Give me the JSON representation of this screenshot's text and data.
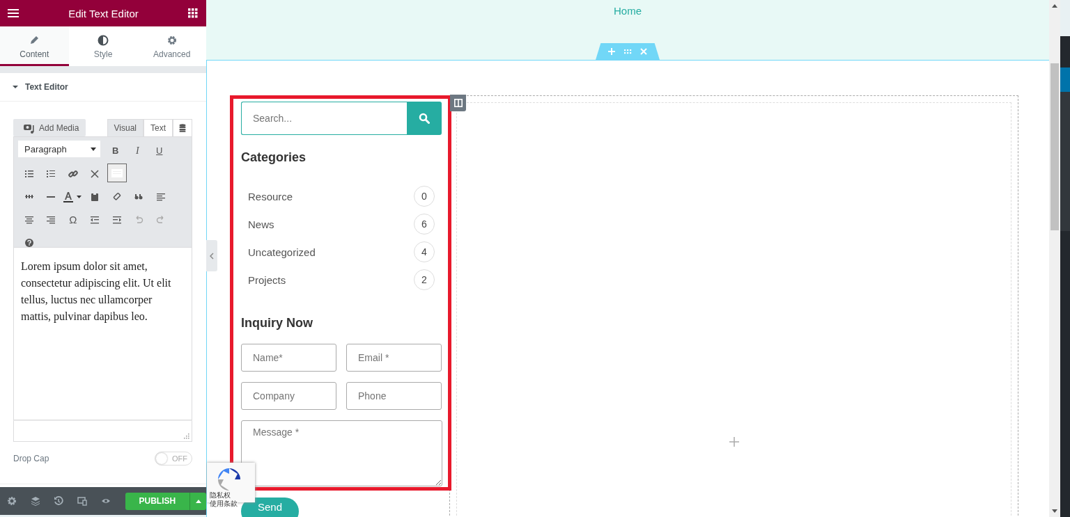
{
  "panel": {
    "title": "Edit Text Editor",
    "tabs": [
      {
        "label": "Content",
        "selected": true
      },
      {
        "label": "Style",
        "selected": false
      },
      {
        "label": "Advanced",
        "selected": false
      }
    ],
    "section": {
      "title": "Text Editor",
      "expanded": true
    },
    "editor": {
      "add_media": "Add Media",
      "modes": [
        {
          "label": "Visual",
          "selected": true
        },
        {
          "label": "Text",
          "selected": false
        }
      ],
      "format": "Paragraph",
      "format_buttons": [
        "B",
        "I",
        "U"
      ],
      "special_char": "Ω",
      "content": "Lorem ipsum dolor sit amet, consectetur adipiscing elit. Ut elit tellus, luctus nec ullamcorper mattis, pulvinar dapibus leo."
    },
    "drop_cap": {
      "label": "Drop Cap",
      "on": false,
      "state_text": "OFF"
    },
    "publish": "PUBLISH"
  },
  "preview": {
    "nav": "Home",
    "widget": {
      "search_placeholder": "Search...",
      "categories_title": "Categories",
      "categories": [
        {
          "name": "Resource",
          "count": "0"
        },
        {
          "name": "News",
          "count": "6"
        },
        {
          "name": "Uncategorized",
          "count": "4"
        },
        {
          "name": "Projects",
          "count": "2"
        }
      ],
      "form_title": "Inquiry Now",
      "fields": [
        {
          "placeholder": "Name*"
        },
        {
          "placeholder": "Email *"
        },
        {
          "placeholder": "Company"
        },
        {
          "placeholder": "Phone"
        }
      ],
      "message_placeholder": "Message *",
      "send": "Send"
    },
    "recaptcha": [
      "隐私权",
      "使用条款"
    ]
  }
}
